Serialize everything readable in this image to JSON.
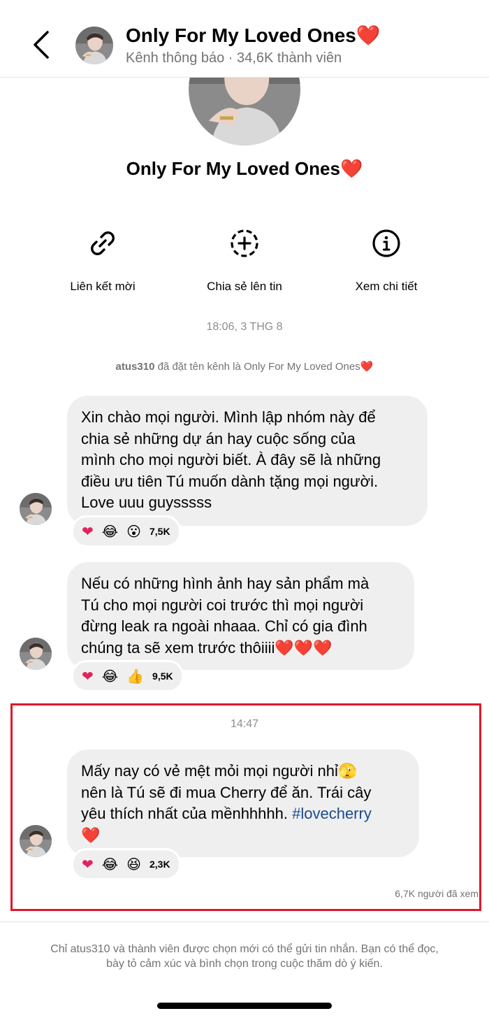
{
  "header": {
    "title": "Only For My Loved Ones❤️",
    "subtitle": "Kênh thông báo · 34,6K thành viên"
  },
  "channel": {
    "name": "Only For My Loved Ones❤️"
  },
  "actions": [
    {
      "label": "Liên kết mời",
      "icon": "link-icon"
    },
    {
      "label": "Chia sẻ lên tin",
      "icon": "add-story-icon"
    },
    {
      "label": "Xem chi tiết",
      "icon": "info-icon"
    }
  ],
  "timeline": {
    "first_time": "18:06, 3 THG 8",
    "system_user": "atus310",
    "system_text": " đã đặt tên kênh là Only For My Loved Ones❤️",
    "second_time": "14:47"
  },
  "messages": [
    {
      "lines": [
        "Xin chào mọi người. Mình lập nhóm này để",
        "chia sẻ những dự án hay cuộc sống của",
        "mình cho mọi người biết. À đây sẽ là những",
        "điều ưu tiên Tú muốn dành tặng mọi người.",
        "Love uuu guysssss"
      ],
      "reactions": [
        "heart",
        "laugh-cry",
        "surprised"
      ],
      "count": "7,5K"
    },
    {
      "lines": [
        "Nếu có những hình ảnh hay sản phẩm mà",
        "Tú cho mọi người coi trước thì mọi người",
        "đừng leak ra ngoài nhaaa. Chỉ có gia đình",
        "chúng ta sẽ xem trước thôiiii❤️❤️❤️"
      ],
      "reactions": [
        "heart",
        "laugh-cry",
        "thumbs-up"
      ],
      "count": "9,5K"
    },
    {
      "lines": [
        "Mấy nay có vẻ mệt mỏi mọi người nhỉ🫣",
        "nên là Tú sẽ đi mua Cherry để ăn. Trái cây",
        "yêu thích nhất của mềnhhhhh. "
      ],
      "hashtag": "#lovecherry",
      "last_line": "❤️",
      "reactions": [
        "heart",
        "laugh-cry",
        "squint-laugh"
      ],
      "count": "2,3K"
    }
  ],
  "seen": "6,7K người đã xem",
  "footer": {
    "line1": "Chỉ atus310 và thành viên được chọn mới có thể gửi tin nhắn. Bạn có thể đọc,",
    "line2": "bày tỏ cảm xúc và bình chọn trong cuộc thăm dò ý kiến."
  },
  "colors": {
    "bubble": "#efefef",
    "highlight_border": "#e0182b",
    "hashtag": "#1b4a8c",
    "heart": "#e0245e"
  }
}
